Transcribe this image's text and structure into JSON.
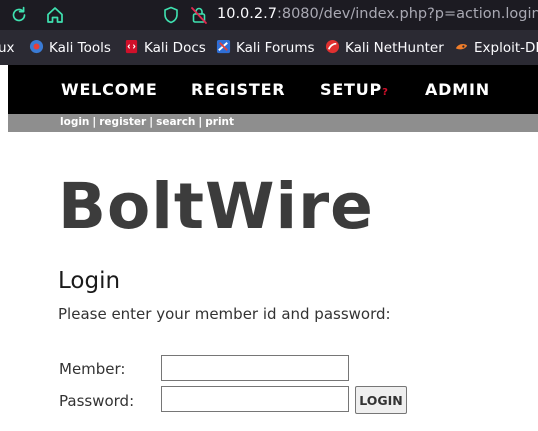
{
  "browser": {
    "url_host": "10.0.2.7",
    "url_rest": ":8080/dev/index.php?p=action.login"
  },
  "bookmarks": [
    {
      "label": "ux"
    },
    {
      "label": "Kali Tools"
    },
    {
      "label": "Kali Docs"
    },
    {
      "label": "Kali Forums"
    },
    {
      "label": "Kali NetHunter"
    },
    {
      "label": "Exploit-DB"
    }
  ],
  "nav": {
    "welcome": "WELCOME",
    "register": "REGISTER",
    "setup": "SETUP",
    "setup_mark": "?",
    "admin": "ADMIN"
  },
  "sub_nav": {
    "login": "login",
    "register": "register",
    "search": "search",
    "print": "print",
    "separator": "|"
  },
  "site_title": "BoltWire",
  "heading": "Login",
  "instructions": "Please enter your member id and password:",
  "form": {
    "member_label": "Member:",
    "member_value": "",
    "password_label": "Password:",
    "password_value": "",
    "login_button": "LOGIN"
  },
  "colors": {
    "toolbar_bg": "#1c1b22",
    "bookmarks_bg": "#2b2a33",
    "nav_bg": "#000000",
    "subnav_bg": "#8e8e8e",
    "accent_green": "#3fe1b0",
    "setup_mark": "#d0102a"
  },
  "icons": [
    "reload-icon",
    "home-icon",
    "shield-icon",
    "insecure-lock-icon"
  ]
}
